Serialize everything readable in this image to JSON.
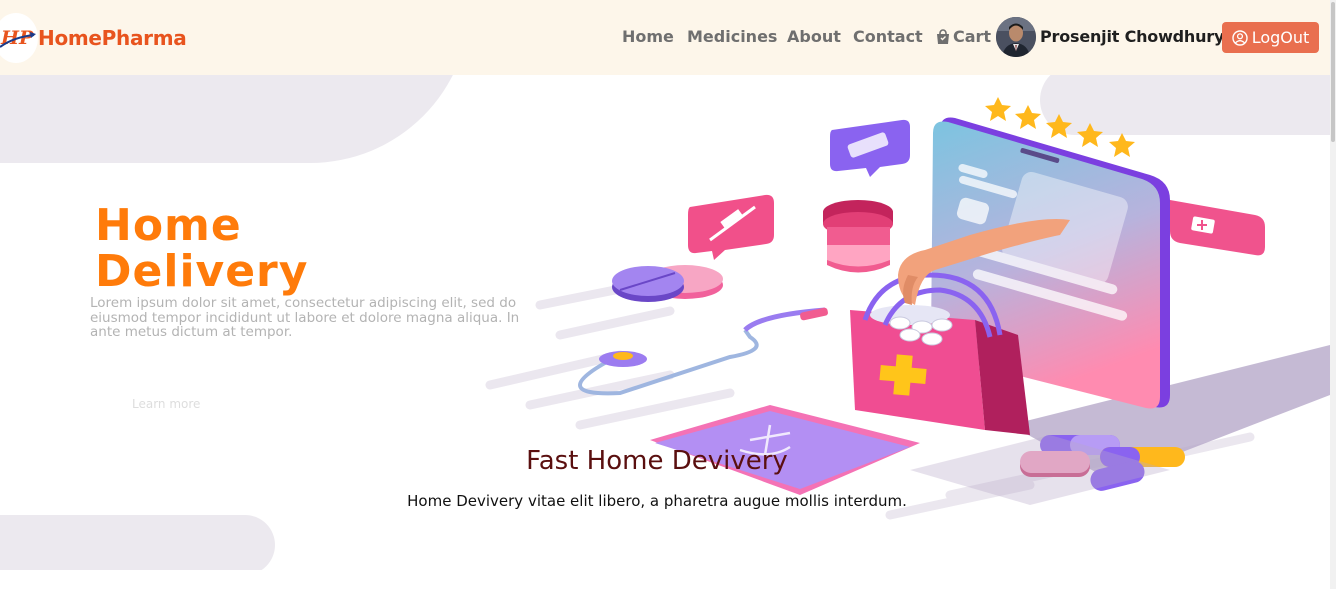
{
  "brand": {
    "name": "HomePharma",
    "logo_text": "HP"
  },
  "nav": {
    "items": [
      {
        "label": "Home"
      },
      {
        "label": "Medicines"
      },
      {
        "label": "About"
      },
      {
        "label": "Contact"
      }
    ],
    "cart_label": "Cart"
  },
  "user": {
    "name": "Prosenjit Chowdhury",
    "logout_label": "LogOut"
  },
  "hero": {
    "title_line1": "Home",
    "title_line2": "Delivery",
    "lorem": "Lorem ipsum dolor sit amet, consectetur adipiscing elit, sed do eiusmod tempor incididunt ut labore et dolore magna aliqua. In ante metus dictum at tempor.",
    "learn_more": "Learn more",
    "caption_title": "Fast Home Devivery",
    "caption_text": "Home Devivery vitae elit libero, a pharetra augue mollis interdum."
  },
  "colors": {
    "navbar_bg": "#fdf6ea",
    "brand": "#e8541e",
    "logout_bg": "#e96f4f",
    "hero_title": "#ff7b0a",
    "caption_title": "#5a0f0f"
  },
  "icons": {
    "cart": "shopping-bag-icon",
    "logout": "user-circle-icon"
  }
}
